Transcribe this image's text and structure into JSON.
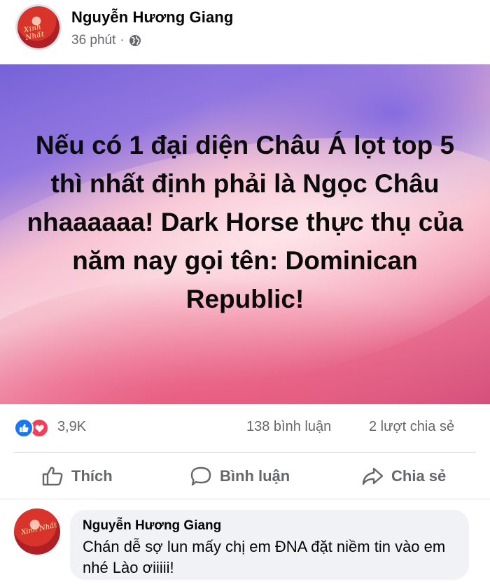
{
  "post": {
    "author": "Nguyễn Hương Giang",
    "time": "36 phút",
    "separator": "·",
    "privacy_icon": "globe-icon",
    "text": "Nếu có 1 đại diện Châu Á lọt top 5 thì nhất định phải là Ngọc Châu nhaaaaaa! Dark Horse thực thụ của năm nay gọi tên: Dominican Republic!"
  },
  "stats": {
    "reactions": "3,9K",
    "reaction_icons": [
      "like-icon",
      "love-icon"
    ],
    "comments": "138 bình luận",
    "shares": "2 lượt chia sẻ"
  },
  "actions": {
    "like": "Thích",
    "comment": "Bình luận",
    "share": "Chia sẻ"
  },
  "comment": {
    "author": "Nguyễn Hương Giang",
    "text": "Chán dễ sợ lun mấy chị em ĐNA đặt niềm tin vào em nhé Lào ơiiiii!"
  },
  "colors": {
    "like_blue": "#1877f2",
    "love_red": "#f33e58",
    "secondary_text": "#65676b",
    "bubble_bg": "#f0f2f5"
  }
}
